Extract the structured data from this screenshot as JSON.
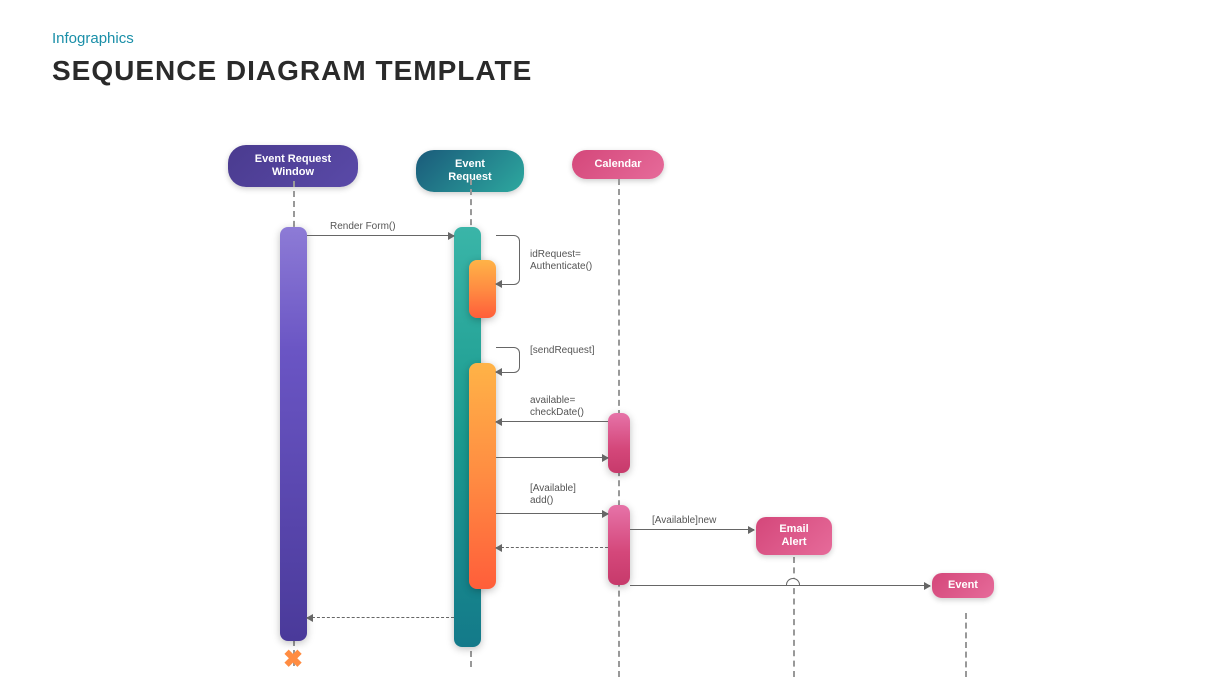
{
  "header": {
    "subtitle": "Infographics",
    "title": "SEQUENCE DIAGRAM TEMPLATE"
  },
  "actors": {
    "eventRequestWindow": "Event Request\nWindow",
    "eventRequest": "Event  Request",
    "calendar": "Calendar",
    "emailAlert": "Email Alert",
    "event": "Event"
  },
  "messages": {
    "renderForm": "Render Form()",
    "authenticate": "idRequest=\nAuthenticate()",
    "sendRequest": "[sendRequest]",
    "checkDate": "available=\ncheckDate()",
    "availableAdd": "[Available]\nadd()",
    "availableNew": "[Available]new"
  },
  "colors": {
    "purple": "#5a4aa8",
    "teal": "#2da89f",
    "pink": "#d4477a",
    "orange": "#ff8c42"
  }
}
